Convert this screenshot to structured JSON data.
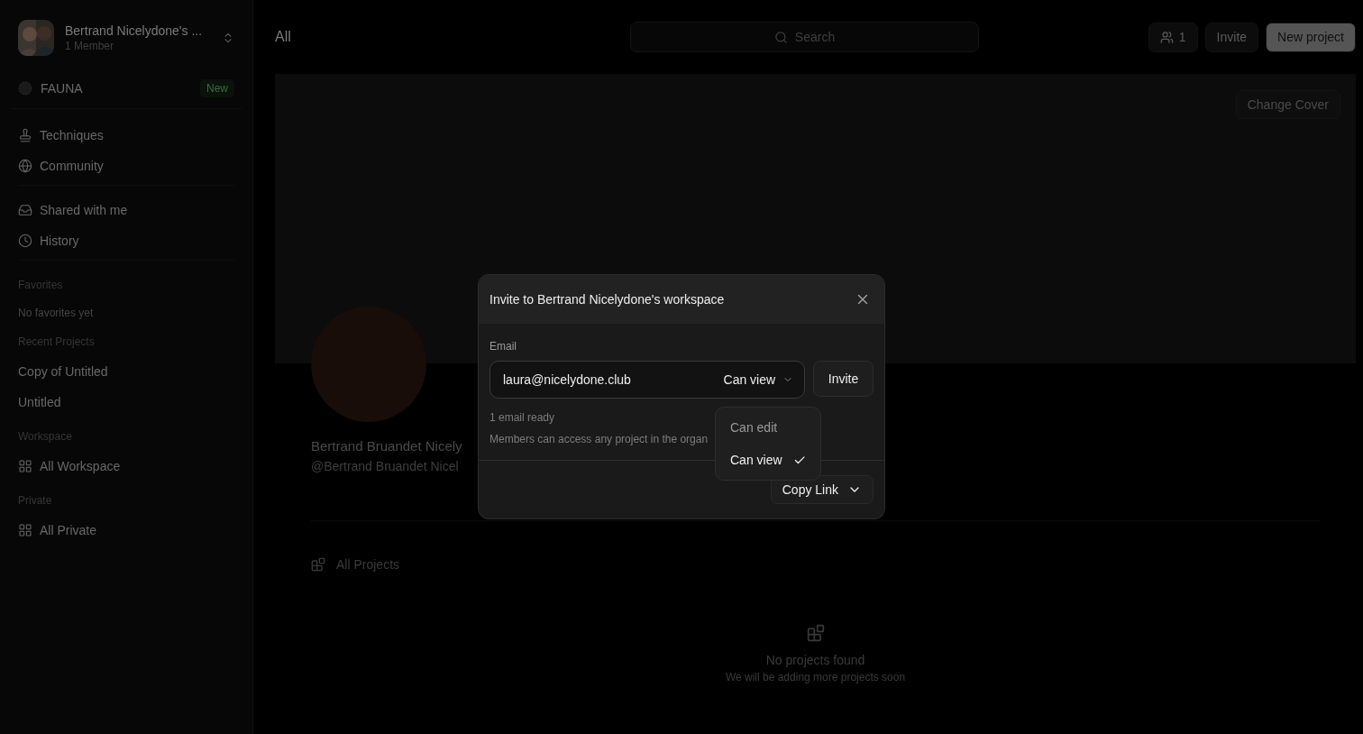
{
  "workspace": {
    "name": "Bertrand Nicelydone's ...",
    "members": "1 Member"
  },
  "sidebar": {
    "promo": {
      "label": "FAUNA",
      "badge": "New"
    },
    "nav_groups": [
      [
        {
          "label": "Techniques"
        },
        {
          "label": "Community"
        }
      ],
      [
        {
          "label": "Shared with me"
        },
        {
          "label": "History"
        }
      ]
    ],
    "sections": [
      {
        "title": "Favorites",
        "empty": "No favorites yet"
      },
      {
        "title": "Recent Projects",
        "items": [
          {
            "label": "Copy of Untitled",
            "kind": "plain"
          },
          {
            "label": "Untitled",
            "kind": "plain"
          }
        ]
      },
      {
        "title": "Workspace",
        "items": [
          {
            "label": "All Workspace",
            "kind": "grid"
          }
        ]
      },
      {
        "title": "Private",
        "items": [
          {
            "label": "All Private",
            "kind": "grid"
          }
        ]
      }
    ]
  },
  "topbar": {
    "title": "All",
    "search": {
      "placeholder": "Search"
    },
    "members_count": "1",
    "invite": "Invite",
    "new_project": "New project"
  },
  "cover": {
    "button": "Change Cover"
  },
  "profile": {
    "name": "Bertrand Bruandet Nicely",
    "handle": "@Bertrand Bruandet Nicel"
  },
  "projects": {
    "title": "All Projects",
    "empty_title": "No projects found",
    "empty_text": "We will be adding more projects soon"
  },
  "dialog": {
    "title": "Invite to Bertrand Nicelydone's workspace",
    "email_label": "Email",
    "email_value": "laura@nicelydone.club",
    "role": "Can view",
    "invite_button": "Invite",
    "status": "1 email ready",
    "note": "Members can access any project in the organ",
    "copy_link": "Copy Link",
    "role_menu": [
      {
        "label": "Can edit",
        "selected": false
      },
      {
        "label": "Can view",
        "selected": true
      }
    ]
  }
}
